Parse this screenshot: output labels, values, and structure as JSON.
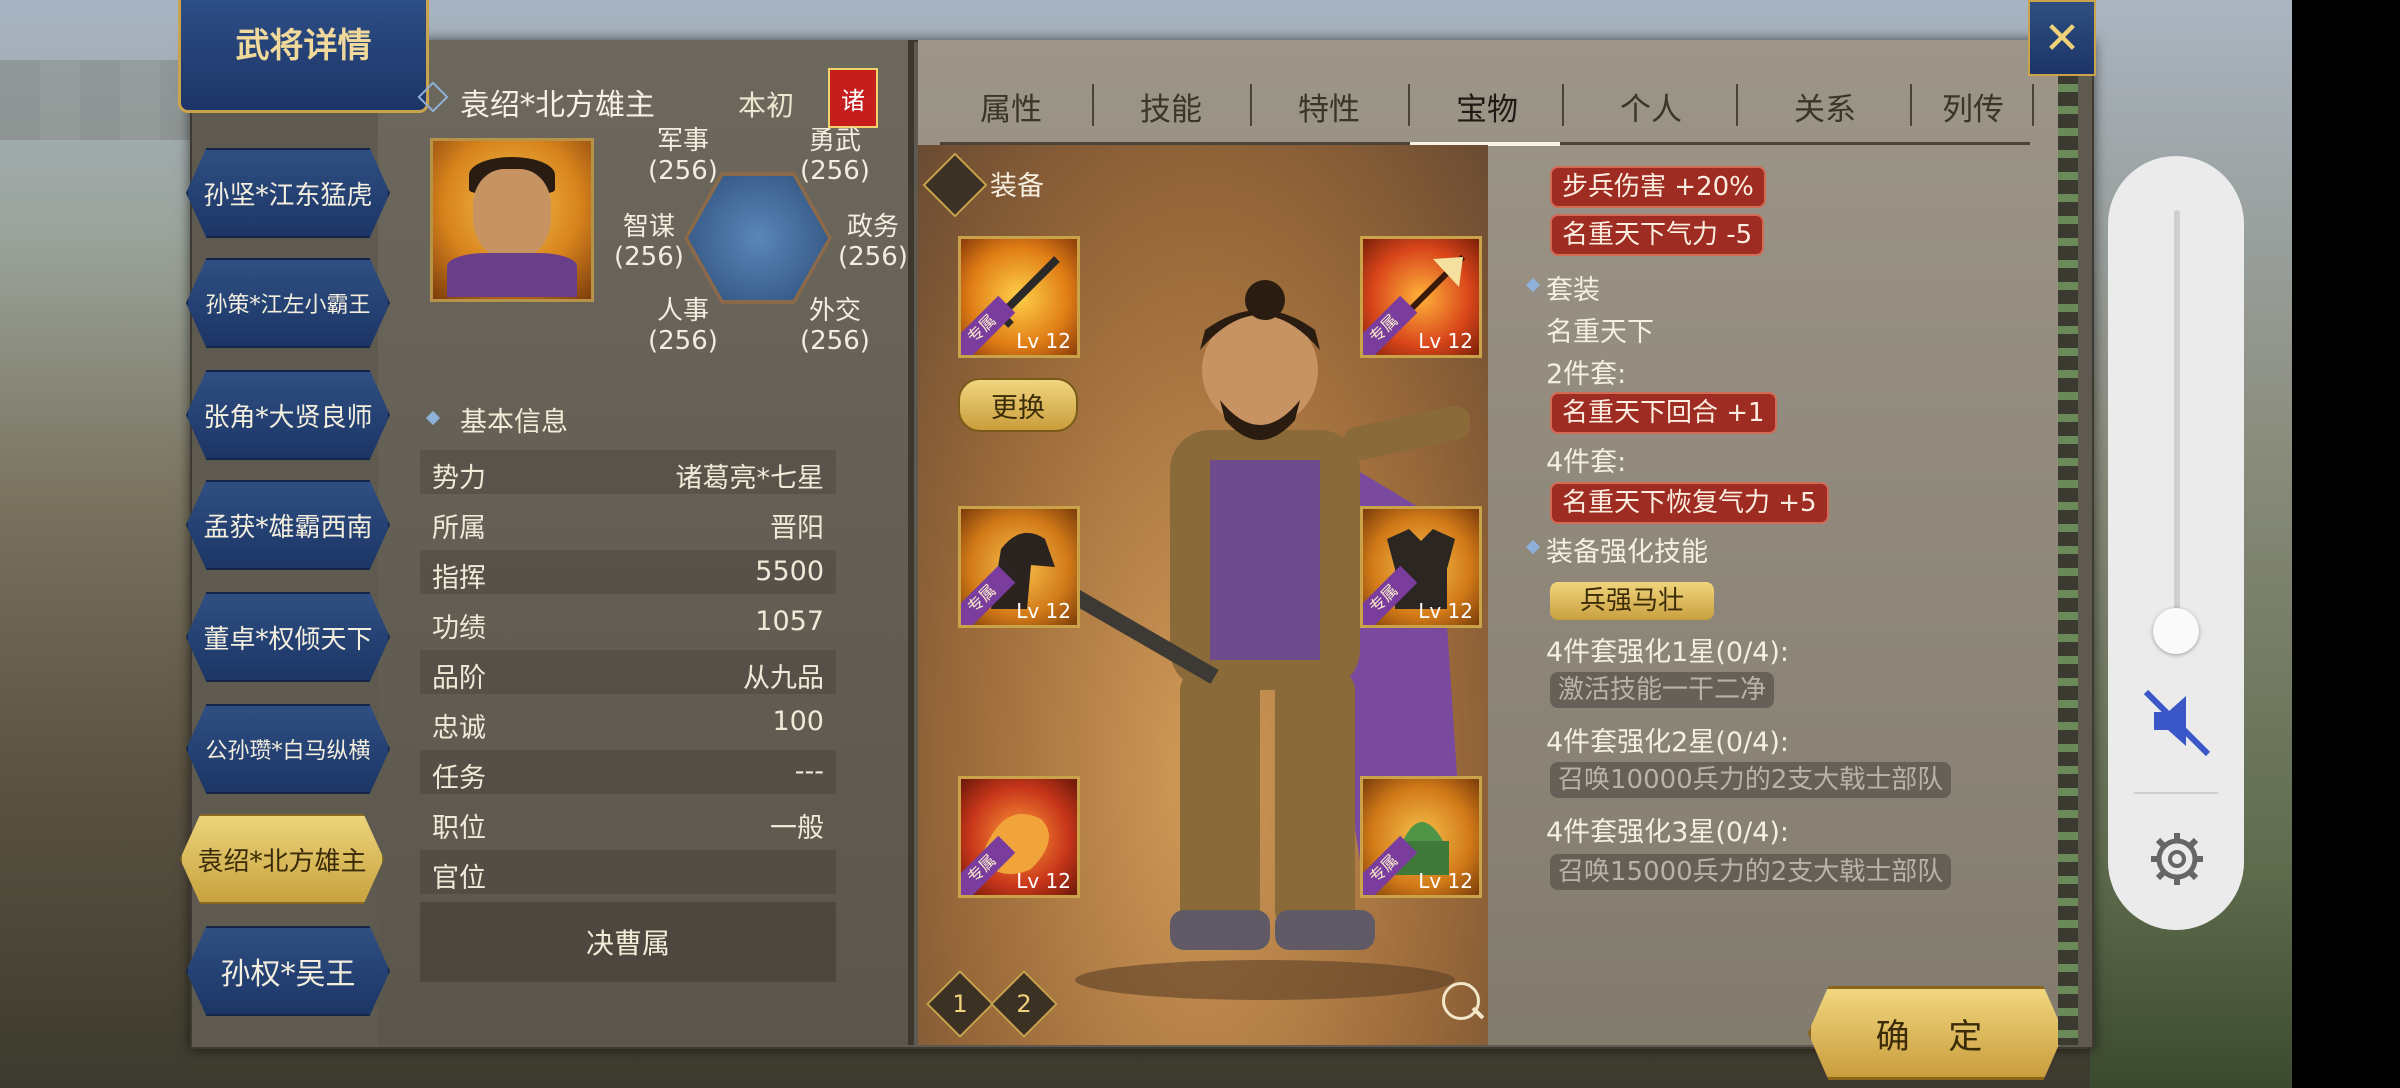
{
  "title": "武将详情",
  "general_list": [
    {
      "label": "孙坚*江东猛虎",
      "active": false
    },
    {
      "label": "孙策*江左小霸王",
      "active": false
    },
    {
      "label": "张角*大贤良师",
      "active": false
    },
    {
      "label": "孟获*雄霸西南",
      "active": false
    },
    {
      "label": "董卓*权倾天下",
      "active": false
    },
    {
      "label": "公孙瓒*白马纵横",
      "active": false
    },
    {
      "label": "袁绍*北方雄主",
      "active": true
    },
    {
      "label": "孙权*吴王",
      "active": false
    }
  ],
  "general": {
    "name": "袁绍*北方雄主",
    "origin": "本初",
    "faction_badge": "诸"
  },
  "stats": {
    "military": {
      "label": "军事",
      "value": "(256)"
    },
    "valor": {
      "label": "勇武",
      "value": "(256)"
    },
    "intellect": {
      "label": "智谋",
      "value": "(256)"
    },
    "politics": {
      "label": "政务",
      "value": "(256)"
    },
    "personnel": {
      "label": "人事",
      "value": "(256)"
    },
    "diplomacy": {
      "label": "外交",
      "value": "(256)"
    }
  },
  "basic_info": {
    "title": "基本信息",
    "rows": [
      {
        "key": "势力",
        "value": "诸葛亮*七星"
      },
      {
        "key": "所属",
        "value": "晋阳"
      },
      {
        "key": "指挥",
        "value": "5500"
      },
      {
        "key": "功绩",
        "value": "1057"
      },
      {
        "key": "品阶",
        "value": "从九品"
      },
      {
        "key": "忠诚",
        "value": "100"
      },
      {
        "key": "任务",
        "value": "---"
      },
      {
        "key": "职位",
        "value": "一般"
      },
      {
        "key": "官位",
        "value": ""
      }
    ],
    "submit_label": "决曹属"
  },
  "tabs": [
    {
      "label": "属性"
    },
    {
      "label": "技能"
    },
    {
      "label": "特性"
    },
    {
      "label": "宝物"
    },
    {
      "label": "个人"
    },
    {
      "label": "关系"
    },
    {
      "label": "列传"
    }
  ],
  "active_tab": "宝物",
  "equipment": {
    "title": "装备",
    "replace_label": "更换",
    "slot_tag": "专属",
    "slots": [
      {
        "icon": "sword-icon",
        "level": "Lv 12"
      },
      {
        "icon": "halberd-icon",
        "level": "Lv 12"
      },
      {
        "icon": "horse-icon",
        "level": "Lv 12"
      },
      {
        "icon": "armor-icon",
        "level": "Lv 12"
      },
      {
        "icon": "dragon-icon",
        "level": "Lv 12"
      },
      {
        "icon": "jade-seal-icon",
        "level": "Lv 12"
      }
    ],
    "pages": [
      "1",
      "2"
    ]
  },
  "details": {
    "effects": [
      "步兵伤害 +20%",
      "名重天下气力 -5"
    ],
    "set_title": "套装",
    "set_name": "名重天下",
    "set2_label": "2件套:",
    "set2_effect": "名重天下回合 +1",
    "set4_label": "4件套:",
    "set4_effect": "名重天下恢复气力 +5",
    "enhance_title": "装备强化技能",
    "enhance_skill": "兵强马壮",
    "star1_label": "4件套强化1星(0/4):",
    "star1_effect": "激活技能一干二净",
    "star2_label": "4件套强化2星(0/4):",
    "star2_effect": "召唤10000兵力的2支大戟士部队",
    "star3_label": "4件套强化3星(0/4):",
    "star3_effect": "召唤15000兵力的2支大戟士部队"
  },
  "confirm_label": "确 定",
  "colors": {
    "panel_dark": "#5f5a50",
    "tag_red": "#9e2c22",
    "gold": "#c99d3c",
    "blue_banner": "#1c3466"
  }
}
